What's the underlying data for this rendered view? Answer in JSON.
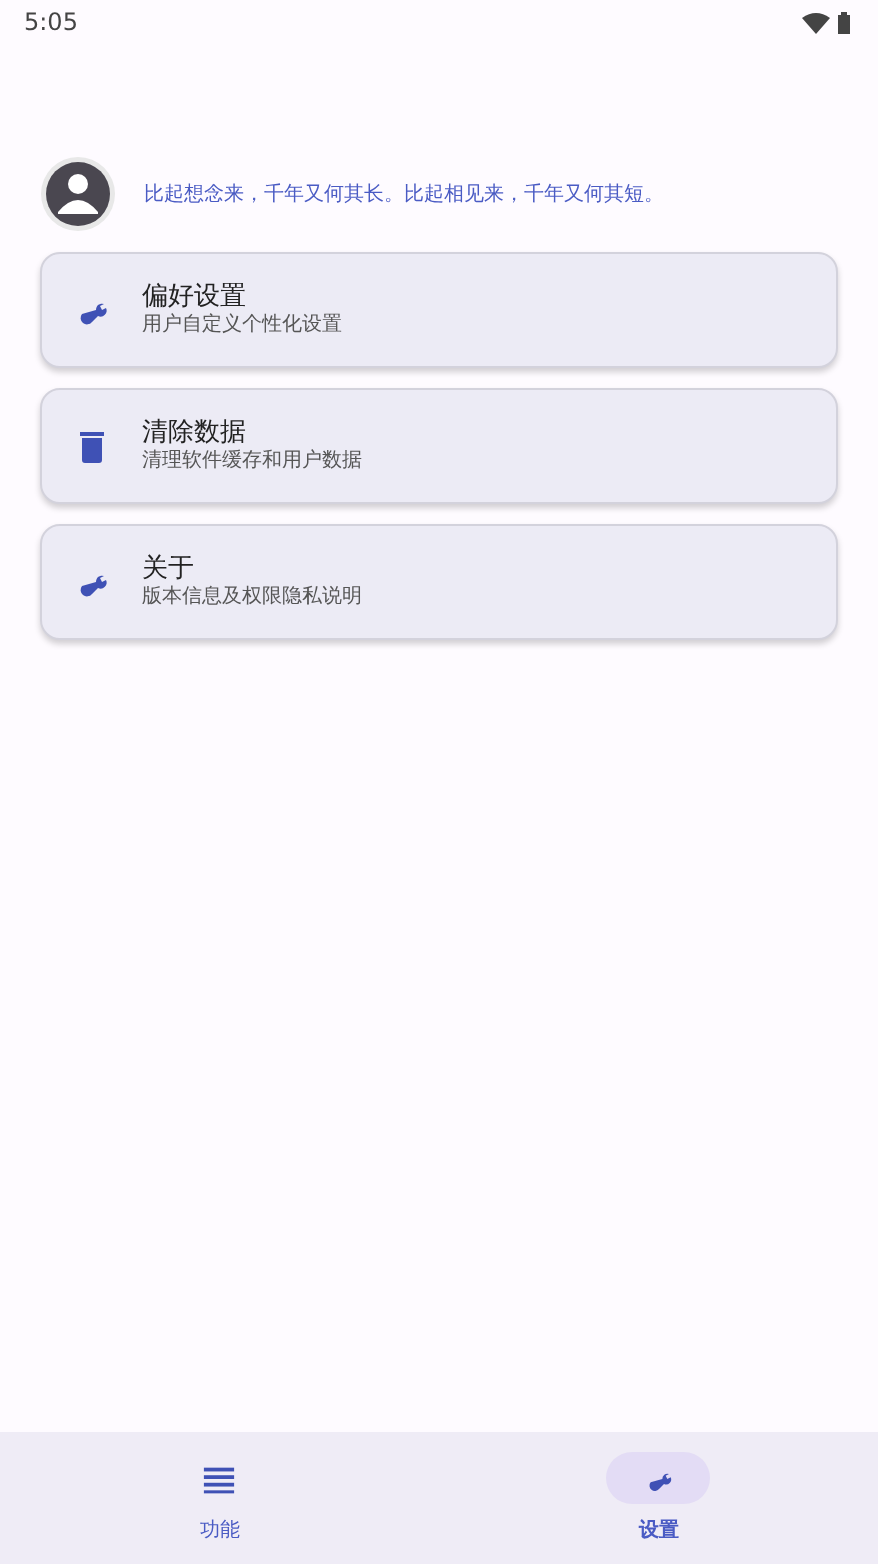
{
  "status_bar": {
    "time": "5:05"
  },
  "profile": {
    "motto": "比起想念来，千年又何其长。比起相见来，千年又何其短。"
  },
  "settings": [
    {
      "kind": "wrench",
      "title": "偏好设置",
      "subtitle": "用户自定义个性化设置"
    },
    {
      "kind": "trash",
      "title": "清除数据",
      "subtitle": "清理软件缓存和用户数据"
    },
    {
      "kind": "wrench",
      "title": "关于",
      "subtitle": "版本信息及权限隐私说明"
    }
  ],
  "bottom_nav": [
    {
      "kind": "menu",
      "label": "功能",
      "selected": false
    },
    {
      "kind": "wrench",
      "label": "设置",
      "selected": true
    }
  ]
}
